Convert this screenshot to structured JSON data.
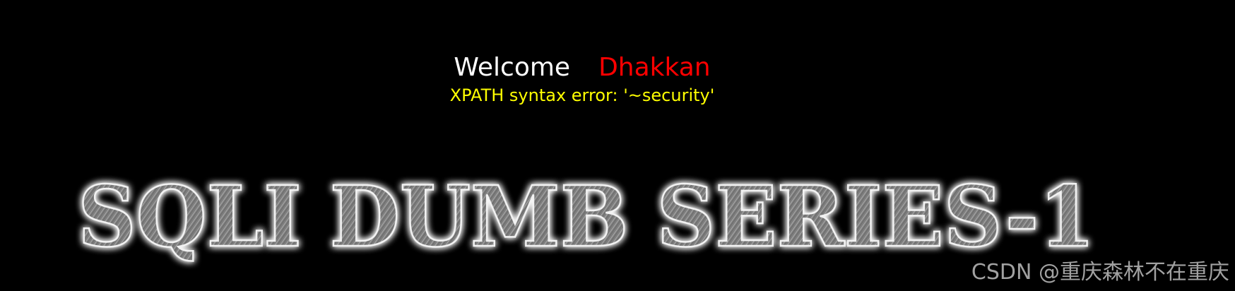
{
  "welcome": {
    "label": "Welcome",
    "username": "Dhakkan"
  },
  "error": {
    "message": "XPATH syntax error: '~security'"
  },
  "banner": {
    "title": "SQLI DUMB SERIES-1"
  },
  "watermark": {
    "text": "CSDN @重庆森林不在重庆"
  },
  "colors": {
    "background": "#000000",
    "welcome_text": "#ffffff",
    "username_text": "#ff0000",
    "error_text": "#ffff00",
    "banner_fill": "#8a8a8a",
    "banner_glow": "#ffffff",
    "watermark_text": "#cfcfcf"
  }
}
